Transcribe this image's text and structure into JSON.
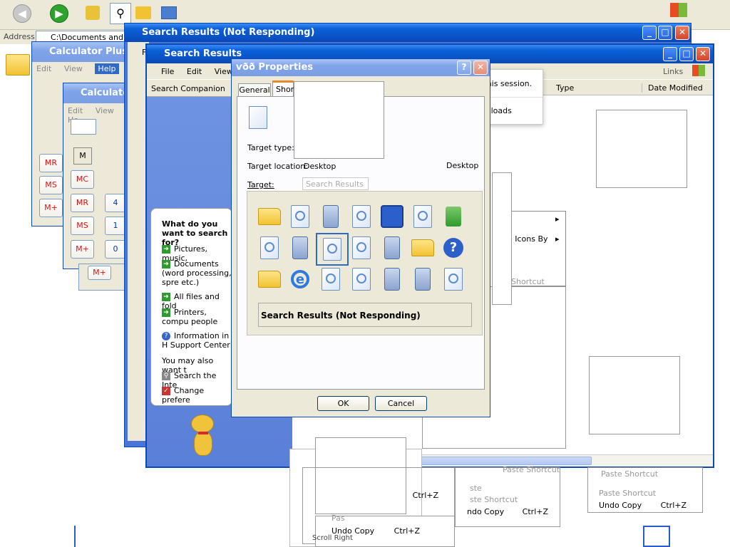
{
  "explorer": {
    "address_label": "Address",
    "address_value": "C:\\Documents and Se"
  },
  "calc_plus": {
    "title": "Calculator Plus",
    "menu": [
      "Edit",
      "View",
      "Help"
    ],
    "keys": [
      "MR",
      "MS",
      "M+"
    ]
  },
  "calc2": {
    "title": "Calculator",
    "menu": [
      "Edit",
      "View",
      "He"
    ],
    "m_label": "M",
    "keys_red": [
      "MC",
      "MR",
      "MS",
      "M+"
    ],
    "keys_num": [
      "4",
      "1",
      "0"
    ],
    "extra": "M+"
  },
  "search_back": {
    "title": "Search Results (Not Responding)",
    "menu_first": "F"
  },
  "search_front": {
    "title": "Search Results",
    "menu": [
      "File",
      "Edit",
      "View"
    ],
    "companion": "Search Companion",
    "links": "Links",
    "col_type": "Type",
    "col_modified": "Date Modified",
    "balloon": {
      "heading": "What do you want to search for?",
      "items": [
        "Pictures, music,",
        "Documents (word processing, spre etc.)",
        "All files and fold",
        "Printers, compu people",
        "Information in H Support Center"
      ],
      "also": "You may also want t",
      "link1": "Search the Inte",
      "link2": "Change prefere"
    }
  },
  "props": {
    "title": "ѵðð Properties",
    "tabs": [
      "General",
      "Shor"
    ],
    "target_type_label": "Target type:",
    "target_location_label": "Target location:",
    "target_location_value": "Desktop",
    "target_location_right": "Desktop",
    "target_label": "Target:",
    "target_value": "Search Results",
    "ok": "OK",
    "cancel": "Cancel"
  },
  "icon_picker": {
    "selected_title": "Search Results (Not Responding)",
    "icons": [
      "folder-icon",
      "search-doc-icon",
      "calculator-icon",
      "search-doc-icon",
      "shortcut-icon",
      "search-doc-icon",
      "recycle-icon",
      "search-doc-icon",
      "calculator-icon",
      "search-doc-icon",
      "search-doc-icon",
      "calculator-icon",
      "folder-icon",
      "help-icon",
      "folder-open-icon",
      "ie-icon",
      "search-doc-icon",
      "search-doc-icon",
      "calculator-icon",
      "calculator-icon",
      "search-doc-icon"
    ]
  },
  "downloads": {
    "message": "No downloads for this session.",
    "show_all": "Show All Downloads"
  },
  "ctx_main": {
    "items": [
      "ge Icons By",
      "h",
      "Shortcut"
    ]
  },
  "ctx_menus": [
    {
      "paste": "Paste Shortcut",
      "paste2": "Paste Shortcut",
      "undo": "Undo Copy",
      "shortcut": "Ctrl+Z"
    },
    {
      "undo": "Undo Copy",
      "shortcut": "Ctrl+Z",
      "scroll": "Scroll Right",
      "pas": "Pas"
    },
    {
      "paste": "Paste Shortcut",
      "undo": "ndo Copy",
      "shortcut": "Ctrl+Z",
      "ste": "ste",
      "ste2": "ste Shortcut"
    },
    {
      "shortcut": "Ctrl+Z"
    }
  ]
}
